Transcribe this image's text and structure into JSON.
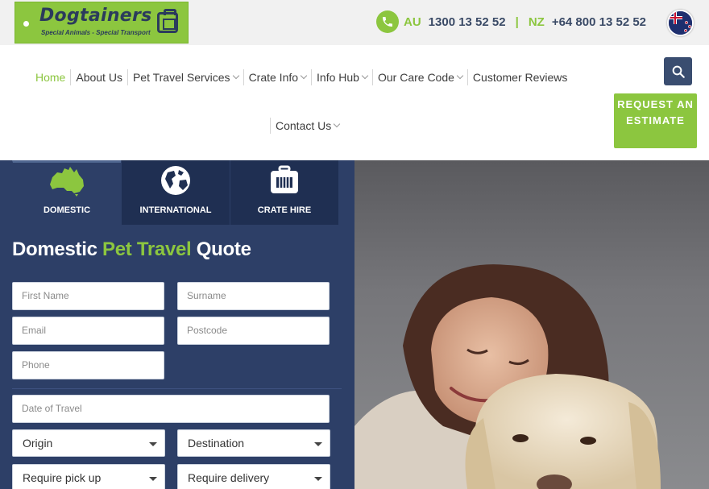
{
  "header": {
    "logo": {
      "brand": "Dogtainers",
      "tagline": "Special Animals - Special Transport"
    },
    "phones": [
      {
        "label": "AU",
        "number": "1300 13 52 52"
      },
      {
        "label": "NZ",
        "number": "+64 800 13 52 52"
      }
    ],
    "separator": "|"
  },
  "nav": {
    "items": [
      {
        "label": "Home",
        "active": true
      },
      {
        "label": "About Us"
      },
      {
        "label": "Pet Travel Services",
        "dropdown": true
      },
      {
        "label": "Crate Info",
        "dropdown": true
      },
      {
        "label": "Info Hub",
        "dropdown": true
      },
      {
        "label": "Our Care Code",
        "dropdown": true
      },
      {
        "label": "Customer Reviews"
      }
    ],
    "row2": [
      {
        "label": "Contact Us",
        "dropdown": true
      }
    ],
    "estimate_label": "REQUEST AN ESTIMATE"
  },
  "quote": {
    "tabs": [
      {
        "label": "DOMESTIC",
        "icon": "australia-map-icon",
        "active": true
      },
      {
        "label": "INTERNATIONAL",
        "icon": "globe-icon"
      },
      {
        "label": "CRATE HIRE",
        "icon": "pet-crate-icon"
      }
    ],
    "title": {
      "part1": "Domestic",
      "part2": "Pet Travel",
      "part3": "Quote"
    },
    "fields": {
      "first_name": "First Name",
      "surname": "Surname",
      "email": "Email",
      "postcode": "Postcode",
      "phone": "Phone",
      "date_of_travel": "Date of Travel"
    },
    "selects": {
      "origin": "Origin",
      "destination": "Destination",
      "pickup": "Require pick up",
      "delivery": "Require delivery"
    }
  },
  "colors": {
    "accent": "#8cc63f",
    "navy": "#2d3f67",
    "navy_dark": "#1f2f52",
    "search": "#3a4d70"
  }
}
